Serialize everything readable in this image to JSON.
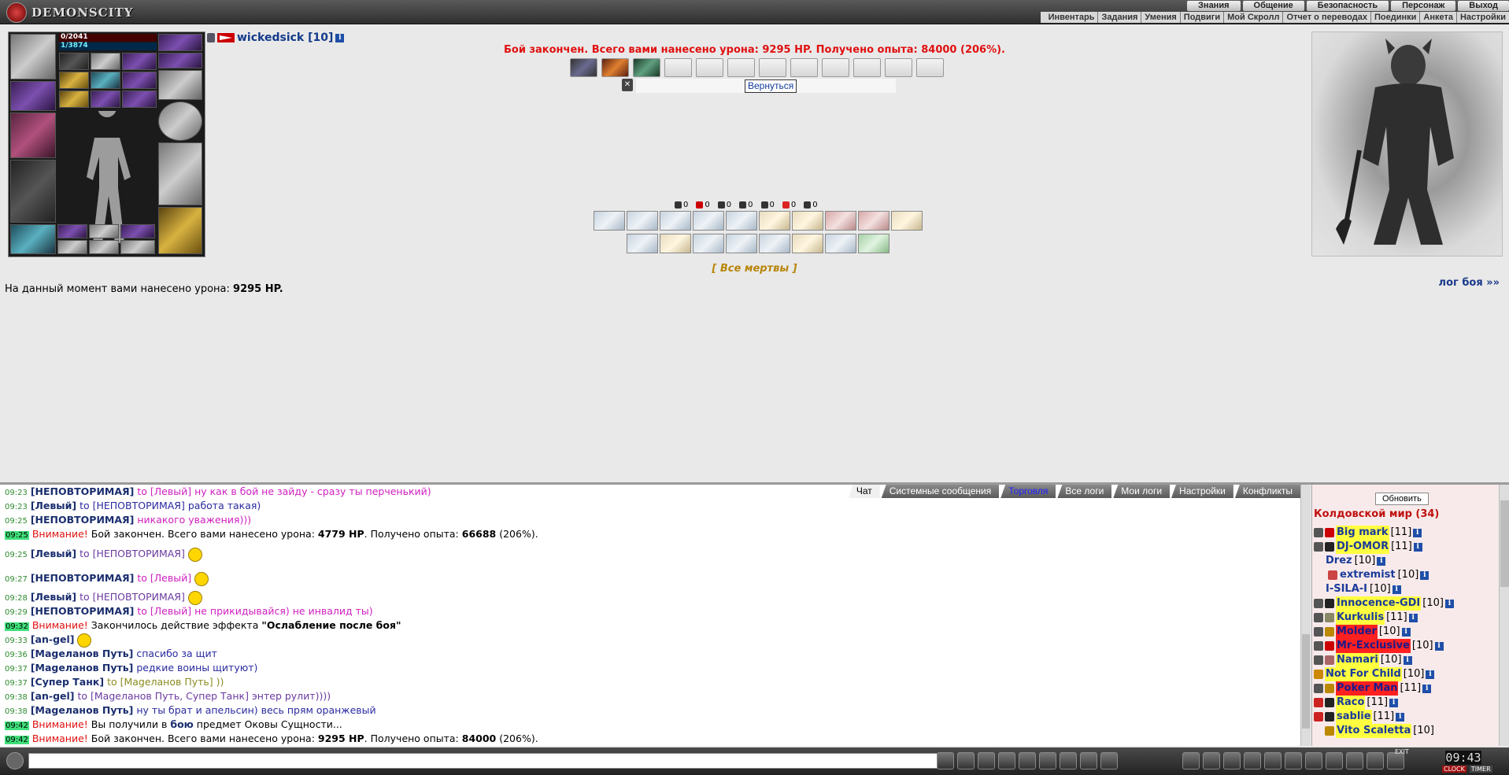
{
  "app": {
    "logo_text": "DEMONSCITY"
  },
  "main_menu": [
    "Знания",
    "Общение",
    "Безопасность",
    "Персонаж",
    "Выход"
  ],
  "sub_menu": [
    "Инвентарь",
    "Задания",
    "Умения",
    "Подвиги",
    "Мой Скролл",
    "Отчет о переводах",
    "Поединки",
    "Анкета",
    "Настройки"
  ],
  "character": {
    "hp": "0/2041",
    "mp": "1/3874",
    "hp_fraction": 0.0,
    "mp_fraction": 0.0003
  },
  "player": {
    "name": "wickedsick [10]"
  },
  "battle": {
    "result": "Бой закончен. Всего вами нанесено урона: 9295 HP. Получено опыта: 84000 (206%).",
    "return_label": "Вернуться",
    "stats": [
      "0",
      "0",
      "0",
      "0",
      "0",
      "0",
      "0"
    ],
    "all_dead": "[ Все мертвы ]",
    "damage_prefix": "На данный момент вами нанесено урона: ",
    "damage_value": "9295 HP.",
    "log_link": "лог боя »»"
  },
  "chat": {
    "tabs": [
      "Чат",
      "Системные сообщения",
      "Торговля",
      "Все логи",
      "Мои логи",
      "Настройки",
      "Конфликты"
    ],
    "lines": [
      {
        "time": "09:23",
        "nick": "[НЕПОВТОРИМАЯ]",
        "to": "to [Левый]",
        "msg": "ну как в бой не зайду - сразу ты перченький)"
      },
      {
        "time": "09:23",
        "nick": "[Левый]",
        "to": "to [НЕПОВТОРИМАЯ]",
        "msg": "работа такая)"
      },
      {
        "time": "09:25",
        "nick": "[НЕПОВТОРИМАЯ]",
        "to": "",
        "msg": "никакого уважения)))"
      },
      {
        "time": "09:25",
        "warn": "Внимание!",
        "a": "Бой закончен. Всего вами нанесено урона: ",
        "b": "4779 HP",
        "c": ". Получено опыта: ",
        "d": "66688",
        "e": " (206%)."
      },
      {
        "time": "09:25",
        "nick": "[Левый]",
        "to": "to [НЕПОВТОРИМАЯ]",
        "msg": ""
      },
      {
        "time": "09:27",
        "nick": "[НЕПОВТОРИМАЯ]",
        "to": "to [Левый]",
        "msg": ""
      },
      {
        "time": "09:28",
        "nick": "[Левый]",
        "to": "to [НЕПОВТОРИМАЯ]",
        "msg": ""
      },
      {
        "time": "09:29",
        "nick": "[НЕПОВТОРИМАЯ]",
        "to": "to [Левый]",
        "msg": "не прикидывайся) не инвалид ты)"
      },
      {
        "time": "09:32",
        "warn": "Внимание!",
        "a": "Закончилось действие эффекта ",
        "b": "\"Ослабление после боя\""
      },
      {
        "time": "09:33",
        "nick": "[an-gel]",
        "msg": ""
      },
      {
        "time": "09:36",
        "nick": "[Мageланов Путь]",
        "msg": "спасибо за щит"
      },
      {
        "time": "09:37",
        "nick": "[Мageланов Путь]",
        "msg": "редкие воины щитуют)"
      },
      {
        "time": "09:37",
        "nick": "[Супер Танк]",
        "to": "to [Мageланов Путь]",
        "msg": "))"
      },
      {
        "time": "09:38",
        "nick": "[an-gel]",
        "to": "to [Мageланов Путь, Супер Танк]",
        "msg": "энтер рулит))))"
      },
      {
        "time": "09:38",
        "nick": "[Мageланов Путь]",
        "msg": "ну ты брат и апельсин) весь прям оранжевый"
      },
      {
        "time": "09:42",
        "warn": "Внимание!",
        "a": "Вы получили в ",
        "b": "бою",
        "c": " предмет Оковы Сущности..."
      },
      {
        "time": "09:42",
        "warn": "Внимание!",
        "a": "Бой закончен. Всего вами нанесено урона: ",
        "b": "9295 HP",
        "c": ". Получено опыта: ",
        "d": "84000",
        "e": " (206%)."
      }
    ]
  },
  "online": {
    "refresh_label": "Обновить",
    "room": "Колдовской мир (34)",
    "users": [
      {
        "name": "Big mark",
        "level": "[11]",
        "hl": "y"
      },
      {
        "name": "DJ-OMOR",
        "level": "[11]",
        "hl": "y"
      },
      {
        "name": "Drez",
        "level": "[10]",
        "hl": ""
      },
      {
        "name": "extremist",
        "level": "[10]",
        "hl": ""
      },
      {
        "name": "I-SILA-I",
        "level": "[10]",
        "hl": ""
      },
      {
        "name": "Innocence-GDI",
        "level": "[10]",
        "hl": "y"
      },
      {
        "name": "Kurkulis",
        "level": "[11]",
        "hl": "y"
      },
      {
        "name": "Molder",
        "level": "[10]",
        "hl": "r"
      },
      {
        "name": "Mr-Exclusive",
        "level": "[10]",
        "hl": "r"
      },
      {
        "name": "Namari",
        "level": "[10]",
        "hl": "y"
      },
      {
        "name": "Not For Child",
        "level": "[10]",
        "hl": "y"
      },
      {
        "name": "Poker Man",
        "level": "[11]",
        "hl": "r"
      },
      {
        "name": "Raco",
        "level": "[11]",
        "hl": "y"
      },
      {
        "name": "sablie",
        "level": "[11]",
        "hl": "y"
      },
      {
        "name": "Vito Scaletta",
        "level": "[10]",
        "hl": "y"
      }
    ]
  },
  "bottom": {
    "clock": "09:43",
    "clock_label": "CLOCK",
    "timer_label": "TIMER",
    "exit_label": "EXIT"
  }
}
